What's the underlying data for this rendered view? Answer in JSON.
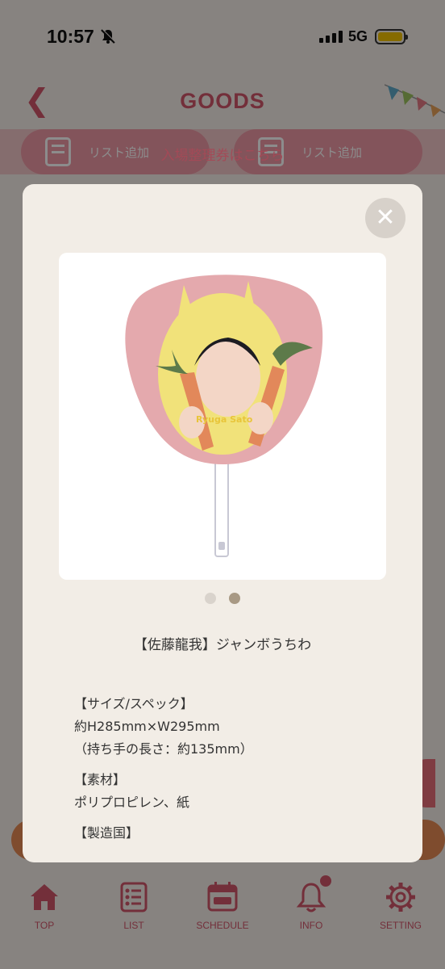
{
  "status": {
    "time": "10:57",
    "network": "5G"
  },
  "nav": {
    "title": "GOODS"
  },
  "ticket_banner": "入場整理券はこちら",
  "list_buttons": [
    "リスト追加",
    "リスト追加"
  ],
  "modal": {
    "product_title": "【佐藤龍我】ジャンボうちわ",
    "specs": [
      "【サイズ/スペック】",
      "約H285mm×W295mm",
      "（持ち手の長さ：約135mm）",
      "【素材】",
      "ポリプロピレン、紙",
      "【製造国】"
    ],
    "carousel": {
      "count": 2,
      "active": 2
    },
    "fan_image_text": "Ryuga Sato"
  },
  "tabs": [
    {
      "label": "TOP",
      "icon": "home-icon"
    },
    {
      "label": "LIST",
      "icon": "list-icon"
    },
    {
      "label": "SCHEDULE",
      "icon": "calendar-ticket-icon"
    },
    {
      "label": "INFO",
      "icon": "bell-icon"
    },
    {
      "label": "SETTING",
      "icon": "gear-icon"
    }
  ],
  "colors": {
    "accent": "#d2566a",
    "modal_bg": "#f2ede6",
    "fan_pink": "#e4a9ad"
  }
}
